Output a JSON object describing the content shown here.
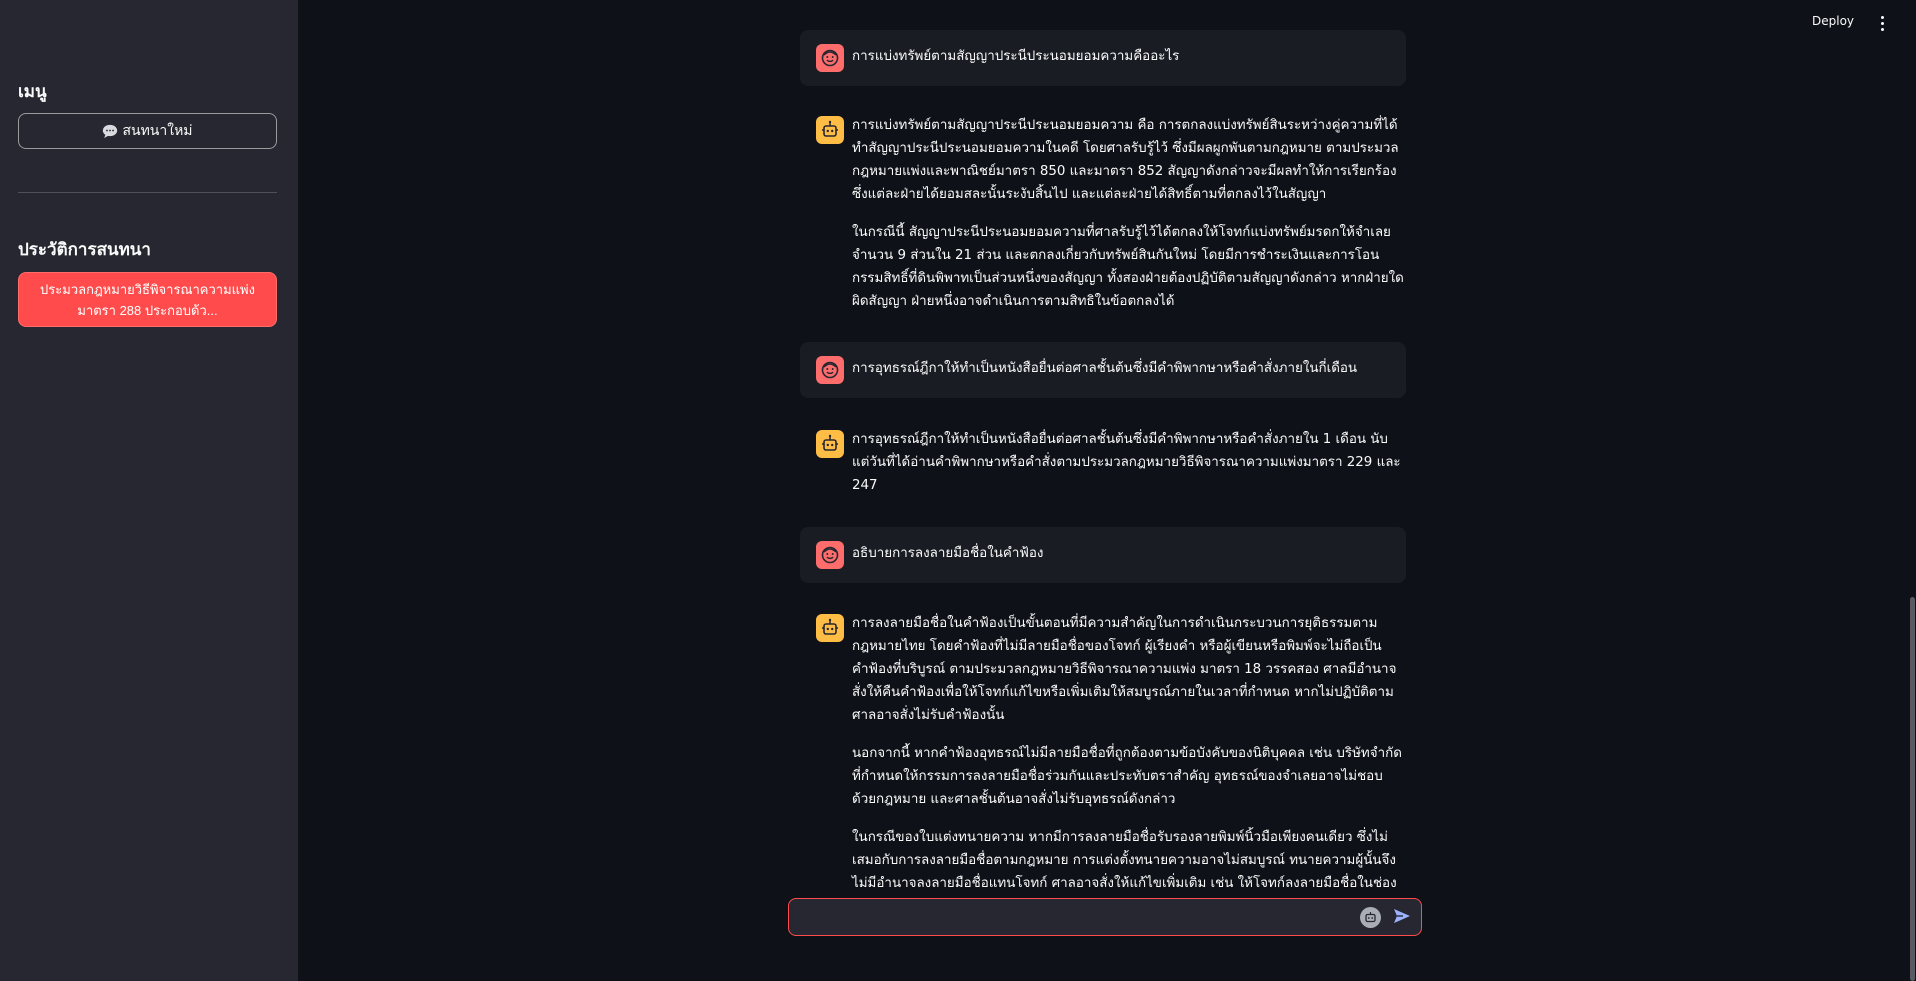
{
  "topbar": {
    "deploy_label": "Deploy",
    "menu_icon": "kebab-menu-icon"
  },
  "sidebar": {
    "menu_title": "เมนู",
    "new_chat_label": "สนทนาใหม่",
    "history_title": "ประวัติการสนทนา",
    "history_items": [
      {
        "label": "ประมวลกฎหมายวิธีพิจารณาความแพ่งมาตรา 288 ประกอบด้ว..."
      }
    ]
  },
  "chat": {
    "messages": [
      {
        "role": "user",
        "paragraphs": [
          "การแบ่งทรัพย์ตามสัญญาประนีประนอมยอมความคืออะไร"
        ]
      },
      {
        "role": "assistant",
        "paragraphs": [
          "การแบ่งทรัพย์ตามสัญญาประนีประนอมยอมความ คือ การตกลงแบ่งทรัพย์สินระหว่างคู่ความที่ได้ทำสัญญาประนีประนอมยอมความในคดี โดยศาลรับรู้ไว้ ซึ่งมีผลผูกพันตามกฎหมาย ตามประมวลกฎหมายแพ่งและพาณิชย์มาตรา 850 และมาตรา 852 สัญญาดังกล่าวจะมีผลทำให้การเรียกร้องซึ่งแต่ละฝ่ายได้ยอมสละนั้นระงับสิ้นไป และแต่ละฝ่ายได้สิทธิ์ตามที่ตกลงไว้ในสัญญา",
          "ในกรณีนี้ สัญญาประนีประนอมยอมความที่ศาลรับรู้ไว้ได้ตกลงให้โจทก์แบ่งทรัพย์มรดกให้จำเลยจำนวน 9 ส่วนใน 21 ส่วน และตกลงเกี่ยวกับทรัพย์สินกันใหม่ โดยมีการชำระเงินและการโอนกรรมสิทธิ์ที่ดินพิพาทเป็นส่วนหนึ่งของสัญญา ทั้งสองฝ่ายต้องปฏิบัติตามสัญญาดังกล่าว หากฝ่ายใดผิดสัญญา ฝ่ายหนึ่งอาจดำเนินการตามสิทธิในข้อตกลงได้"
        ]
      },
      {
        "role": "user",
        "paragraphs": [
          "การอุทธรณ์ฎีกาให้ทำเป็นหนังสือยื่นต่อศาลชั้นต้นซึ่งมีคำพิพากษาหรือคำสั่งภายในกี่เดือน"
        ]
      },
      {
        "role": "assistant",
        "paragraphs": [
          "การอุทธรณ์ฎีกาให้ทำเป็นหนังสือยื่นต่อศาลชั้นต้นซึ่งมีคำพิพากษาหรือคำสั่งภายใน 1 เดือน นับแต่วันที่ได้อ่านคำพิพากษาหรือคำสั่งตามประมวลกฎหมายวิธีพิจารณาความแพ่งมาตรา 229 และ 247"
        ]
      },
      {
        "role": "user",
        "paragraphs": [
          "อธิบายการลงลายมือชื่อในคำฟ้อง"
        ]
      },
      {
        "role": "assistant",
        "paragraphs": [
          "การลงลายมือชื่อในคำฟ้องเป็นขั้นตอนที่มีความสำคัญในการดำเนินกระบวนการยุติธรรมตามกฎหมายไทย โดยคำฟ้องที่ไม่มีลายมือชื่อของโจทก์ ผู้เรียงคำ หรือผู้เขียนหรือพิมพ์จะไม่ถือเป็นคำฟ้องที่บริบูรณ์ ตามประมวลกฎหมายวิธีพิจารณาความแพ่ง มาตรา 18 วรรคสอง ศาลมีอำนาจสั่งให้คืนคำฟ้องเพื่อให้โจทก์แก้ไขหรือเพิ่มเติมให้สมบูรณ์ภายในเวลาที่กำหนด หากไม่ปฏิบัติตามศาลอาจสั่งไม่รับคำฟ้องนั้น",
          "นอกจากนี้ หากคำฟ้องอุทธรณ์ไม่มีลายมือชื่อที่ถูกต้องตามข้อบังคับของนิติบุคคล เช่น บริษัทจำกัด ที่กำหนดให้กรรมการลงลายมือชื่อร่วมกันและประทับตราสำคัญ อุทธรณ์ของจำเลยอาจไม่ชอบด้วยกฎหมาย และศาลชั้นต้นอาจสั่งไม่รับอุทธรณ์ดังกล่าว",
          "ในกรณีของใบแต่งทนายความ หากมีการลงลายมือชื่อรับรองลายพิมพ์นิ้วมือเพียงคนเดียว ซึ่งไม่เสมอกับการลงลายมือชื่อตามกฎหมาย การแต่งตั้งทนายความอาจไม่สมบูรณ์ ทนายความผู้นั้นจึงไม่มีอำนาจลงลายมือชื่อแทนโจทก์ ศาลอาจสั่งให้แก้ไขเพิ่มเติม เช่น ให้โจทก์ลงลายมือชื่อในช่อง"
        ]
      }
    ]
  },
  "input": {
    "placeholder": "",
    "value": ""
  },
  "icons": {
    "user_avatar": "user-avatar-icon",
    "bot_avatar": "bot-avatar-icon",
    "send": "send-icon",
    "new_chat": "speech-bubble-icon"
  },
  "colors": {
    "sidebar_bg": "#262730",
    "main_bg": "#0e1117",
    "accent": "#ff4b4b",
    "user_avatar": "#ff6c6c",
    "bot_avatar": "#ffbd45",
    "user_msg_bg": "#1a1c24"
  }
}
